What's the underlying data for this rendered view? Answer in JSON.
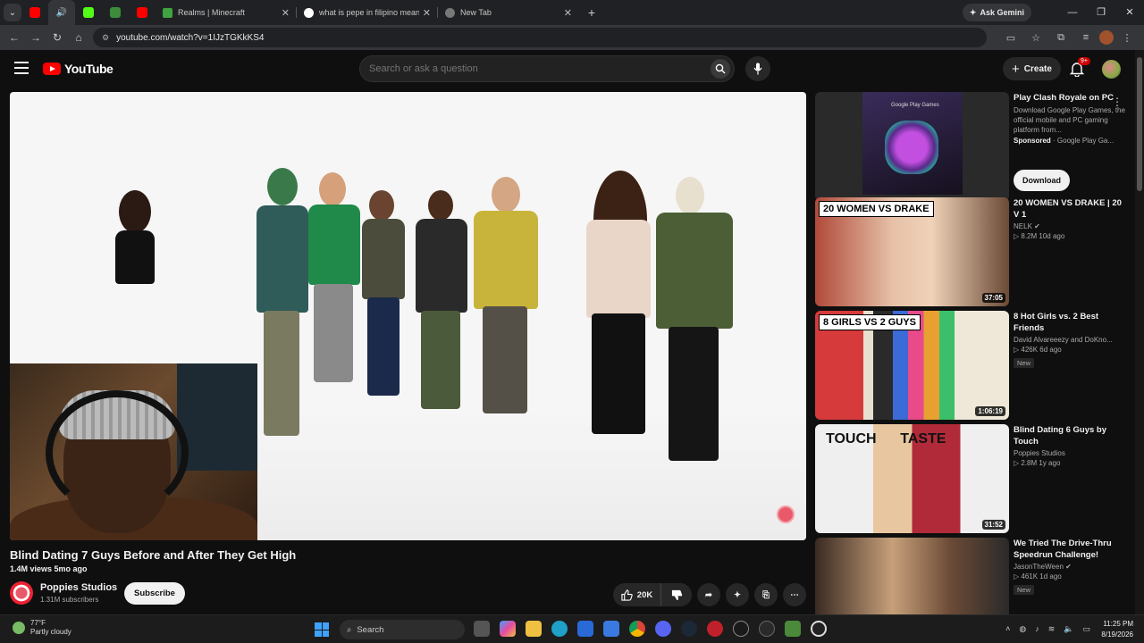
{
  "browser": {
    "tabs": [
      {
        "title": "Realms | Minecraft",
        "color": "#3fa33f"
      },
      {
        "title": "what is pepe in filipino meaning",
        "color": "#4285f4"
      },
      {
        "title": "New Tab",
        "color": "#888888"
      }
    ],
    "gemini_label": "Ask Gemini",
    "url": "youtube.com/watch?v=1IJzTGKkKS4"
  },
  "youtube": {
    "logo_text": "YouTube",
    "search_placeholder": "Search or ask a question",
    "create_label": "Create",
    "notif_badge": "9+"
  },
  "video": {
    "title": "Blind Dating 7 Guys Before and After They Get High",
    "meta": "1.4M views  5mo ago",
    "channel": "Poppies Studios",
    "subs": "1.31M subscribers",
    "subscribe_label": "Subscribe",
    "likes": "20K"
  },
  "sidebar": {
    "ad": {
      "title": "Play Clash Royale on PC",
      "desc": "Download Google Play Games, the official mobile and PC gaming platform from...",
      "sponsored": "Sponsored",
      "source": "· Google Play Ga...",
      "button": "Download",
      "thumb_text": "Google Play Games"
    },
    "items": [
      {
        "title": "20 WOMEN VS DRAKE | 20 V 1",
        "channel": "NELK",
        "meta": "▷ 8.2M  10d ago",
        "duration": "37:05",
        "banner": "20 WOMEN VS DRAKE",
        "new": ""
      },
      {
        "title": "8 Hot Girls vs. 2 Best Friends",
        "channel": "David Alvareeezy  and DoKno...",
        "meta": "▷ 426K  6d ago",
        "duration": "1:06:19",
        "banner": "8 GIRLS VS 2 GUYS",
        "new": "New"
      },
      {
        "title": "Blind Dating 6 Guys by Touch",
        "channel": "Poppies Studios",
        "meta": "▷ 2.8M  1y ago",
        "duration": "31:52",
        "banner": "TOUCH      TASTE",
        "new": ""
      },
      {
        "title": "We Tried The Drive-Thru Speedrun Challenge!",
        "channel": "JasonTheWeen",
        "meta": "▷ 461K  1d ago",
        "duration": "",
        "banner": "",
        "new": "New"
      }
    ]
  },
  "taskbar": {
    "temp": "77°F",
    "weather": "Partly cloudy",
    "search_label": "Search",
    "time": "11:25 PM",
    "date": "8/19/2026"
  }
}
